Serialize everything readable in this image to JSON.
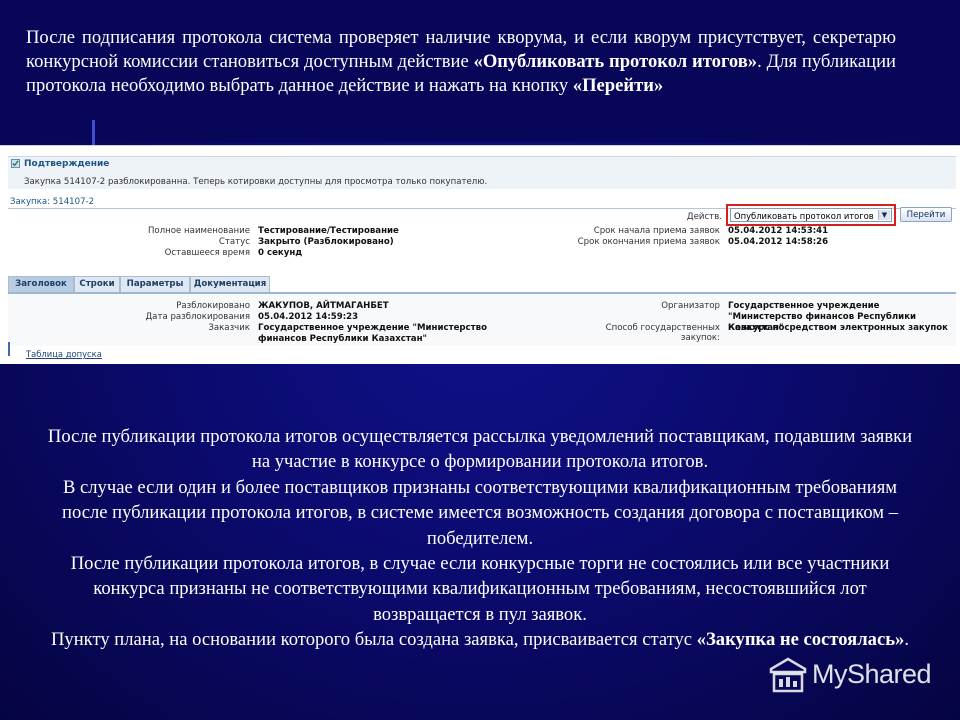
{
  "slide": {
    "intro": {
      "before": "После подписания протокола система проверяет наличие кворума, и если кворум присутствует, секретарю конкурсной комиссии становиться доступным действие ",
      "bold1": "«Опубликовать протокол итогов»",
      "middle": ". Для публикации протокола необходимо выбрать данное действие и нажать на кнопку ",
      "bold2": "«Перейти»"
    },
    "outro": {
      "p1": "После публикации протокола итогов осуществляется рассылка уведомлений поставщикам, подавшим заявки на участие в конкурсе о формировании протокола итогов.",
      "p2": "В случае если один и более поставщиков признаны соответствующими квалификационным требованиям после публикации протокола итогов, в системе имеется возможность создания договора с поставщиком – победителем.",
      "p3": "После публикации протокола итогов, в случае если конкурсные торги не состоялись или все участники конкурса признаны не соответствующими квалификационным требованиям, несостоявшийся лот возвращается в пул заявок.",
      "p4_before": "Пункту плана, на основании которого была создана заявка, присваивается статус ",
      "p4_bold": "«Закупка не состоялась»",
      "p4_after": "."
    },
    "watermark": "MyShared"
  },
  "screenshot": {
    "confirmation_title": "Подтверждение",
    "confirmation_message": "Закупка 514107-2 разблокированна. Теперь котировки доступны для просмотра только покупателю.",
    "procurement_label": "Закупка: 514107-2",
    "action_label": "Действ.",
    "action_selected": "Опубликовать протокол итогов",
    "go_button": "Перейти",
    "header_fields": [
      {
        "label": "Полное наименование",
        "value": "Тестирование/Тестирование"
      },
      {
        "label": "Статус",
        "value": "Закрыто (Разблокировано)"
      },
      {
        "label": "Оставшееся время",
        "value": "0 секунд"
      }
    ],
    "date_fields": [
      {
        "label": "Срок начала приема заявок",
        "value": "05.04.2012 14:53:41"
      },
      {
        "label": "Срок окончания приема заявок",
        "value": "05.04.2012 14:58:26"
      }
    ],
    "tabs": [
      "Заголовок",
      "Строки",
      "Параметры",
      "Документация"
    ],
    "detail_left": [
      {
        "label": "Разблокировано",
        "value": "ЖАКУПОВ, АЙТМАГАНБЕТ"
      },
      {
        "label": "Дата разблокирования",
        "value": "05.04.2012 14:59:23"
      },
      {
        "label": "Заказчик",
        "value": "Государственное учреждение \"Министерство финансов Республики Казахстан\""
      }
    ],
    "detail_right": [
      {
        "label": "Организатор",
        "value": "Государственное учреждение \"Министерство финансов Республики Казахстан\""
      },
      {
        "label": "Способ государственных закупок:",
        "value": "Конкурс посредством электронных закупок"
      }
    ],
    "bottom_link": "Таблица допуска"
  },
  "colors": {
    "slide_background": "#0b0a6e",
    "highlight_frame": "#d42020",
    "link_blue": "#225588"
  }
}
